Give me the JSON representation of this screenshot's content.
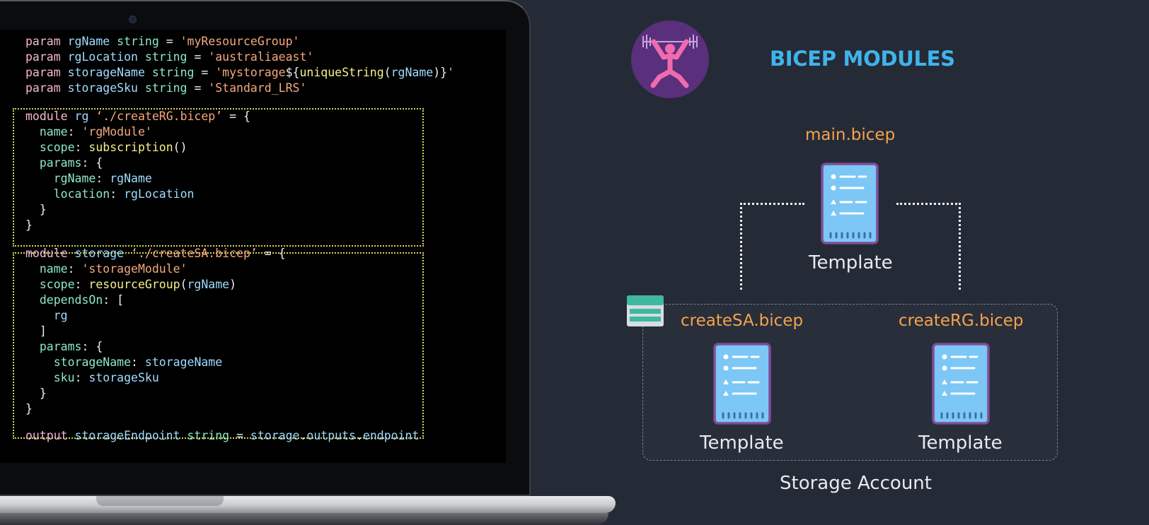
{
  "diagram": {
    "title": "BICEP MODULES",
    "main_file": "main.bicep",
    "main_template_label": "Template",
    "modules": [
      {
        "file": "createSA.bicep",
        "template_label": "Template"
      },
      {
        "file": "createRG.bicep",
        "template_label": "Template"
      }
    ],
    "storage_label": "Storage Account",
    "colors": {
      "background": "#252a37",
      "title": "#3fb4ea",
      "file_label": "#f4a34b",
      "document": "#7cc7f5",
      "document_border": "#7d4e9a",
      "logo_bg": "#5a2f7c",
      "logo_figure": "#f06bae"
    },
    "icons": [
      "weightlifter-icon",
      "document-icon",
      "storage-table-icon"
    ]
  },
  "editor": {
    "code_lines": [
      "param rgName string = 'myResourceGroup'",
      "param rgLocation string = 'australiaeast'",
      "param storageName string = 'mystorage${uniqueString(rgName)}'",
      "param storageSku string = 'Standard_LRS'",
      "module rg ‘./createRG.bicep’ = {",
      "  name: 'rgModule'",
      "  scope: subscription()",
      "  params: {",
      "    rgName: rgName",
      "    location: rgLocation",
      "  }",
      "}",
      "module storage ‘./createSA.bicep’ = {",
      "  name: 'storageModule'",
      "  scope: resourceGroup(rgName)",
      "  dependsOn: [",
      "    rg",
      "  ]",
      "  params: {",
      "    storageName: storageName",
      "    sku: storageSku",
      "  }",
      "}",
      "output storageEndpoint string = storage.outputs.endpoint"
    ],
    "colors": {
      "keyword": "#f5b8d6",
      "type": "#8ee8c4",
      "string": "#f5a97f",
      "identifier": "#9fdcff",
      "function": "#f5f08c",
      "plain": "#eceff4",
      "module_box_border": "#d6d65a"
    }
  }
}
